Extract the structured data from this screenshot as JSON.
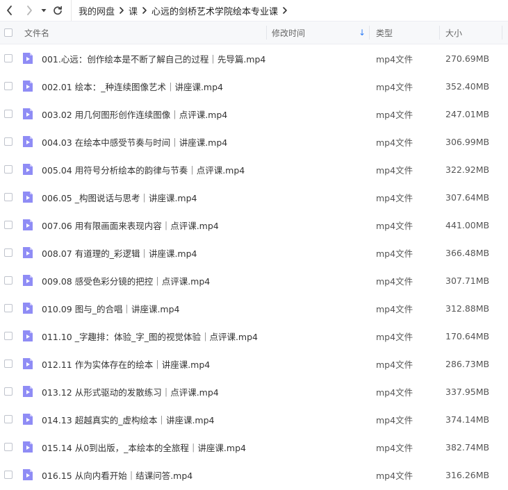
{
  "breadcrumb": {
    "items": [
      "我的网盘",
      "课",
      "心远的剑桥艺术学院绘本专业课"
    ]
  },
  "table": {
    "columns": {
      "name": "文件名",
      "modified": "修改时间",
      "type": "类型",
      "size": "大小"
    },
    "sort_indicator": "↓",
    "rows": [
      {
        "name": "001.心远：创作绘本是不断了解自己的过程｜先导篇.mp4",
        "type": "mp4文件",
        "size": "270.69MB"
      },
      {
        "name": "002.01 绘本：_种连续图像艺术｜讲座课.mp4",
        "type": "mp4文件",
        "size": "352.40MB"
      },
      {
        "name": "003.02 用几何图形创作连续图像｜点评课.mp4",
        "type": "mp4文件",
        "size": "247.01MB"
      },
      {
        "name": "004.03 在绘本中感受节奏与时间｜讲座课.mp4",
        "type": "mp4文件",
        "size": "306.99MB"
      },
      {
        "name": "005.04 用符号分析绘本的韵律与节奏｜点评课.mp4",
        "type": "mp4文件",
        "size": "322.92MB"
      },
      {
        "name": "006.05 _构图说话与思考｜讲座课.mp4",
        "type": "mp4文件",
        "size": "307.64MB"
      },
      {
        "name": "007.06 用有限画面来表现内容｜点评课.mp4",
        "type": "mp4文件",
        "size": "441.00MB"
      },
      {
        "name": "008.07 有道理的_彩逻辑｜讲座课.mp4",
        "type": "mp4文件",
        "size": "366.48MB"
      },
      {
        "name": "009.08 感受色彩分镜的把控｜点评课.mp4",
        "type": "mp4文件",
        "size": "307.71MB"
      },
      {
        "name": "010.09 图与_的合唱｜讲座课.mp4",
        "type": "mp4文件",
        "size": "312.88MB"
      },
      {
        "name": "011.10 _字趣排：体验_字_图的视觉体验｜点评课.mp4",
        "type": "mp4文件",
        "size": "170.64MB"
      },
      {
        "name": "012.11 作为实体存在的绘本｜讲座课.mp4",
        "type": "mp4文件",
        "size": "286.73MB"
      },
      {
        "name": "013.12  从形式驱动的发散练习｜点评课.mp4",
        "type": "mp4文件",
        "size": "337.95MB"
      },
      {
        "name": "014.13 超越真实的_虚构绘本｜讲座课.mp4",
        "type": "mp4文件",
        "size": "374.14MB"
      },
      {
        "name": "015.14 从0到出版，_本绘本的全旅程｜讲座课.mp4",
        "type": "mp4文件",
        "size": "382.74MB"
      },
      {
        "name": "016.15 从向内看开始｜结课问答.mp4",
        "type": "mp4文件",
        "size": "316.26MB"
      }
    ]
  },
  "colors": {
    "file_icon": "#8f8cf5",
    "sort_arrow": "#2f7df6",
    "header_bg": "#f7f8fa"
  },
  "icons": {
    "back": "chevron-left-icon",
    "forward": "chevron-right-icon",
    "history": "caret-down-icon",
    "refresh": "refresh-icon",
    "file": "video-file-icon"
  }
}
